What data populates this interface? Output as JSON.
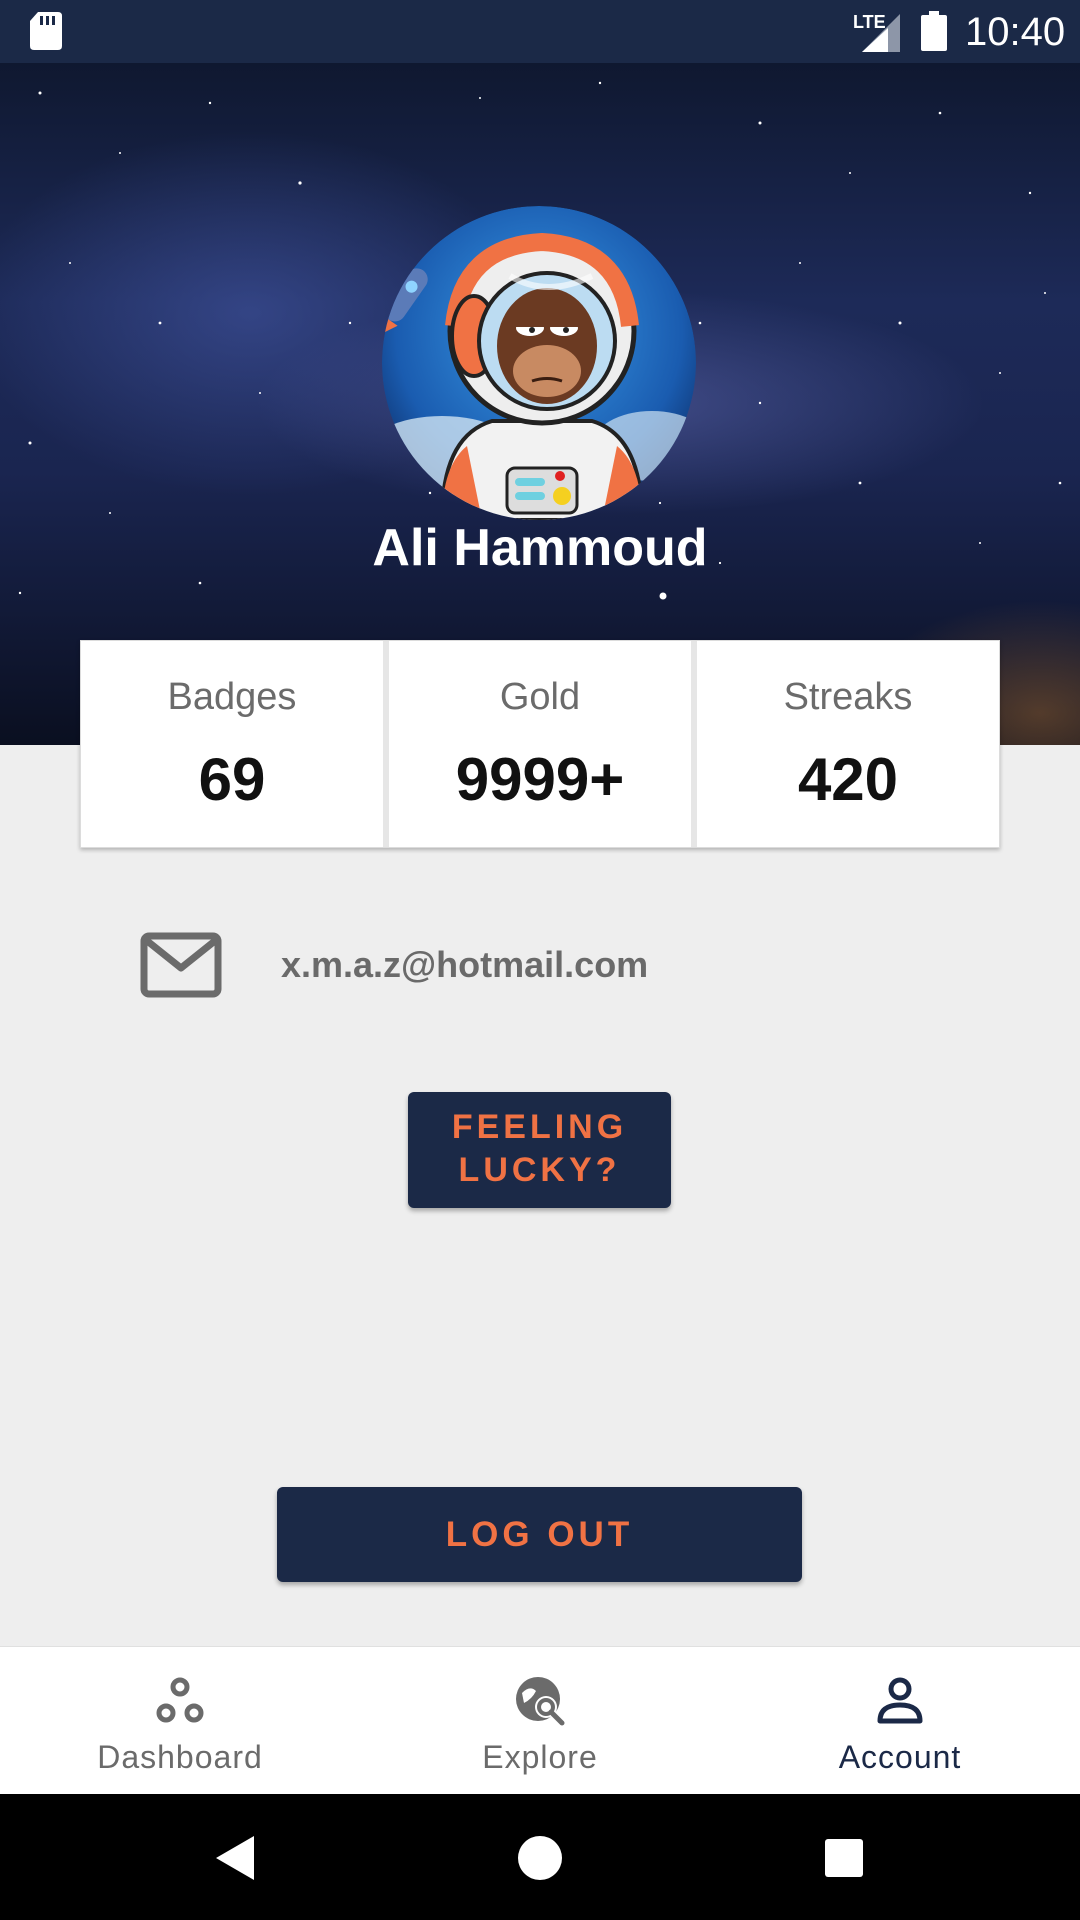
{
  "status_bar": {
    "time": "10:40",
    "network": "LTE",
    "icons": [
      "sd-card-icon",
      "signal-icon",
      "battery-icon"
    ]
  },
  "profile": {
    "name": "Ali Hammoud",
    "avatar": "astronaut-ape-avatar"
  },
  "stats": [
    {
      "label": "Badges",
      "value": "69"
    },
    {
      "label": "Gold",
      "value": "9999+"
    },
    {
      "label": "Streaks",
      "value": "420"
    }
  ],
  "contact": {
    "email": "x.m.a.z@hotmail.com",
    "icon": "mail-icon"
  },
  "actions": {
    "lucky_line1": "FEELING",
    "lucky_line2": "LUCKY?",
    "logout": "LOG OUT"
  },
  "bottom_nav": {
    "items": [
      {
        "label": "Dashboard",
        "icon": "dashboard-icon",
        "active": false
      },
      {
        "label": "Explore",
        "icon": "explore-icon",
        "active": false
      },
      {
        "label": "Account",
        "icon": "account-icon",
        "active": true
      }
    ]
  },
  "colors": {
    "primary": "#1b2947",
    "accent": "#f07244",
    "background": "#eeeeee",
    "nav_inactive": "#6b6b6b"
  }
}
